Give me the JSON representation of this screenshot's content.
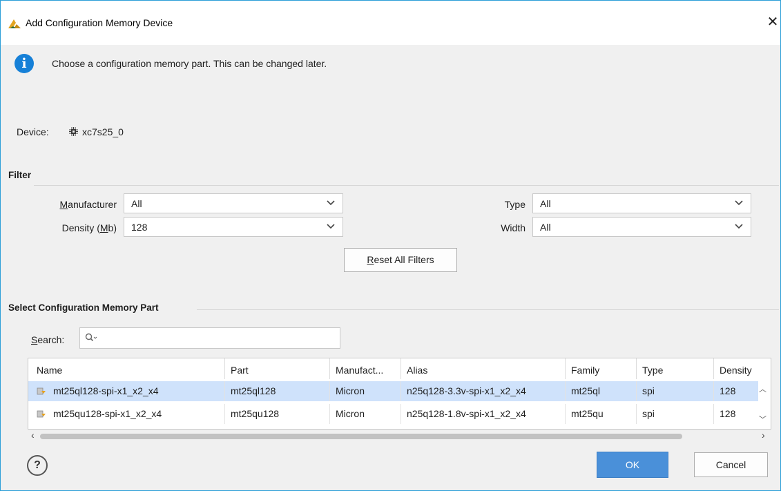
{
  "window": {
    "title": "Add Configuration Memory Device",
    "close_glyph": "✕"
  },
  "info": {
    "message": "Choose a configuration memory part. This can be changed later.",
    "icon": "info-icon"
  },
  "device": {
    "label": "Device:",
    "value": "xc7s25_0",
    "icon": "chip-icon"
  },
  "filter": {
    "title": "Filter",
    "manufacturer": {
      "label_underlined": "M",
      "label_rest": "anufacturer",
      "value": "All"
    },
    "density": {
      "label_prefix": "Density (",
      "label_underlined": "M",
      "label_suffix": "b)",
      "value": "128"
    },
    "type": {
      "label": "Type",
      "value": "All"
    },
    "width": {
      "label": "Width",
      "value": "All"
    },
    "reset": {
      "underlined": "R",
      "rest": "eset All Filters"
    }
  },
  "part_section": {
    "title": "Select Configuration Memory Part",
    "search": {
      "label_underlined": "S",
      "label_rest": "earch:",
      "placeholder": "",
      "icon": "search-icon"
    }
  },
  "table": {
    "columns": [
      "Name",
      "Part",
      "Manufact...",
      "Alias",
      "Family",
      "Type",
      "Density"
    ],
    "rows": [
      [
        "mt25ql128-spi-x1_x2_x4",
        "mt25ql128",
        "Micron",
        "n25q128-3.3v-spi-x1_x2_x4",
        "mt25ql",
        "spi",
        "128"
      ],
      [
        "mt25qu128-spi-x1_x2_x4",
        "mt25qu128",
        "Micron",
        "n25q128-1.8v-spi-x1_x2_x4",
        "mt25qu",
        "spi",
        "128"
      ]
    ],
    "selected_row": 0
  },
  "footer": {
    "help": "?",
    "ok": "OK",
    "cancel": "Cancel"
  },
  "colors": {
    "accent": "#4a90d9",
    "selection": "#cfe2fb",
    "info": "#1680d7",
    "logo": "#e3a521"
  }
}
